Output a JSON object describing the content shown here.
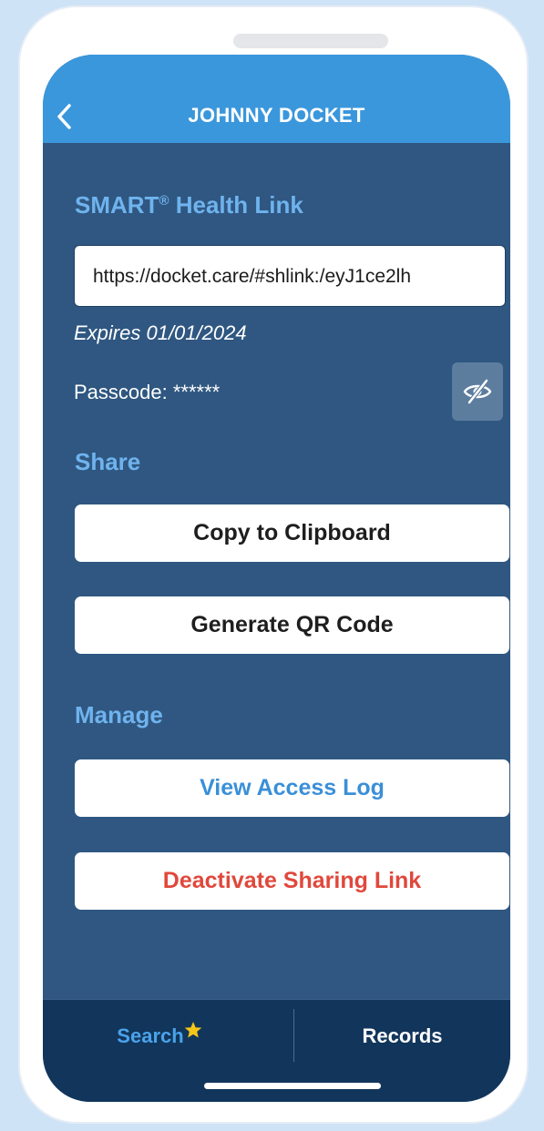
{
  "header": {
    "title": "JOHNNY DOCKET",
    "back_icon": "chevron-left-icon"
  },
  "health_link": {
    "section_label": "SMART",
    "section_sup": "®",
    "section_label_rest": " Health Link",
    "url": "https://docket.care/#shlink:/eyJ1ce2lh",
    "expires": "Expires 01/01/2024",
    "passcode": "Passcode: ******",
    "toggle_icon": "eye-slash-icon"
  },
  "share": {
    "section_label": "Share",
    "copy_label": "Copy to Clipboard",
    "qr_label": "Generate QR Code"
  },
  "manage": {
    "section_label": "Manage",
    "access_log_label": "View Access Log",
    "deactivate_label": "Deactivate Sharing Link"
  },
  "tabbar": {
    "search_label": "Search",
    "records_label": "Records"
  },
  "colors": {
    "header": "#3a97dc",
    "screen": "#2f5781",
    "accent_blue": "#3a8fd8",
    "danger": "#e0483c",
    "tabbar": "#12355b",
    "star": "#f5c518"
  }
}
